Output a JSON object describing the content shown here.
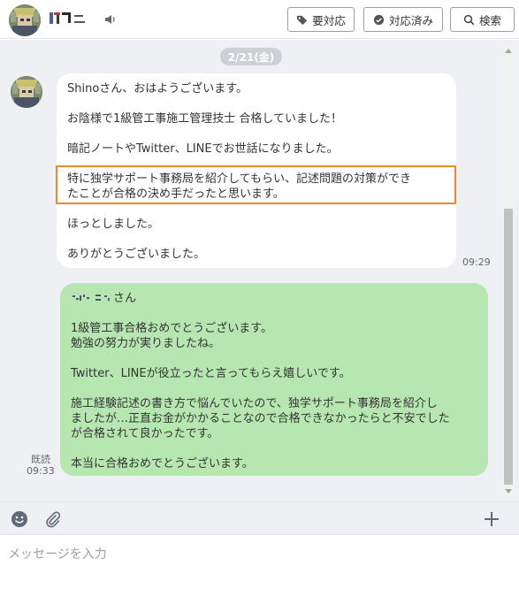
{
  "header": {
    "needs_action_label": "要対応",
    "resolved_label": "対応済み",
    "search_label": "検索"
  },
  "chat": {
    "date_label": "2/21(金)",
    "incoming": {
      "lines": [
        "Shinoさん、おはようございます。",
        "お陰様で1級管工事施工管理技士 合格していました！",
        "暗記ノートやTwitter、LINEでお世話になりました。",
        "特に独学サポート事務局を紹介してもらい、記述問題の対策ができ",
        "たことが合格の決め手だったと思います。",
        "ほっとしました。",
        "ありがとうございました。"
      ],
      "time": "09:29"
    },
    "outgoing": {
      "salutation_suffix": "さん",
      "lines": [
        "1級管工事合格おめでとうございます。",
        "勉強の努力が実りましたね。",
        "Twitter、LINEが役立ったと言ってもらえ嬉しいです。",
        "施工経験記述の書き方で悩んでいたので、独学サポート事務局を紹介し",
        "ましたが…正直お金がかかることなので合格できなかったらと不安でした",
        "が合格されて良かったです。",
        "本当に合格おめでとうございます。"
      ],
      "read_label": "既読",
      "time": "09:33"
    }
  },
  "composer": {
    "placeholder": "メッセージを入力"
  },
  "icons": {
    "speaker": "speaker-icon",
    "needs_action": "tag-icon",
    "resolved": "check-circle-icon",
    "search": "search-icon",
    "emoji": "smiley-icon",
    "attach": "paperclip-icon",
    "add": "plus-icon"
  },
  "colors": {
    "chat_background": "#eef0f3",
    "incoming_bubble": "#ffffff",
    "outgoing_bubble": "#b7e7b1",
    "highlight_border": "#f08a24",
    "date_pill": "#cdd1d6"
  }
}
